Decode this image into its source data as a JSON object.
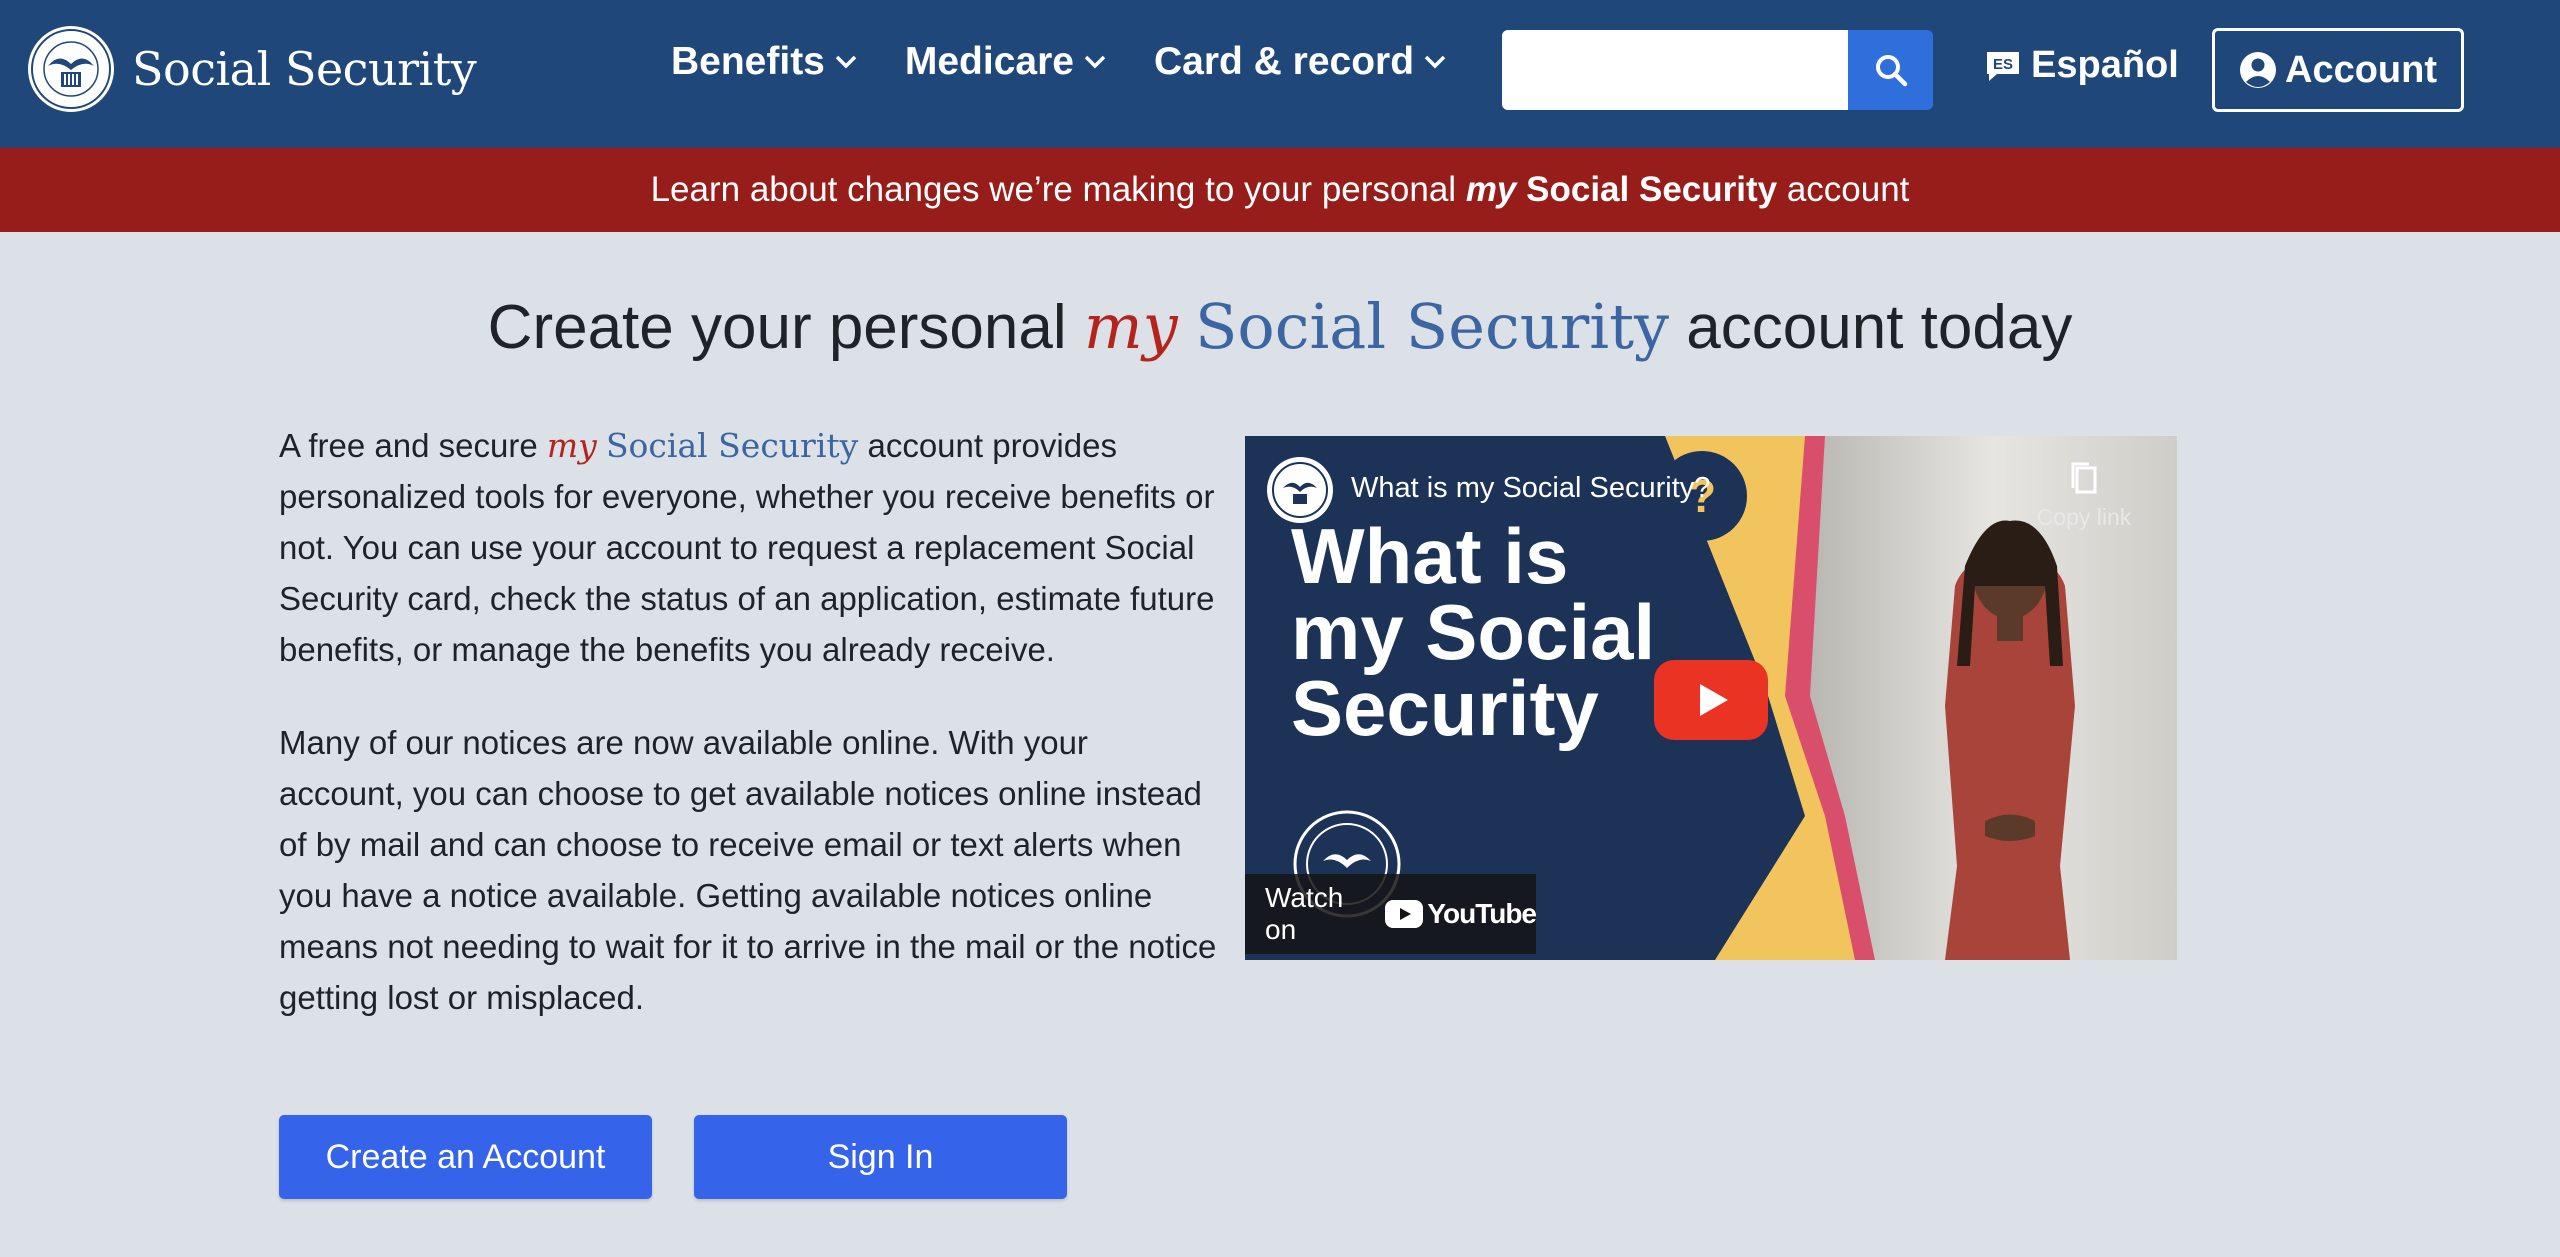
{
  "header": {
    "logo_text": "Social Security",
    "nav": [
      {
        "label": "Benefits"
      },
      {
        "label": "Medicare"
      },
      {
        "label": "Card & record"
      }
    ],
    "search_placeholder": "",
    "espanol": "Español",
    "account": "Account"
  },
  "banner": {
    "prefix": "Learn about changes we’re making to your personal ",
    "my": "my",
    "ss": "Social Security",
    "suffix": " account"
  },
  "hero": {
    "prefix": "Create your personal ",
    "my": "my",
    "ss": "Social Security",
    "suffix": " account today"
  },
  "intro": {
    "p1_prefix": "A free and secure ",
    "p1_my": "my",
    "p1_ss": "Social Security",
    "p1_rest": " account provides personalized tools for everyone, whether you receive benefits or not. You can use your account to request a replacement Social Security card, check the status of an application, estimate future benefits, or manage the benefits you already receive.",
    "p2": "Many of our notices are now available online. With your account, you can choose to get available notices online instead of by mail and can choose to receive email or text alerts when you have a notice available. Getting available notices online means not needing to wait for it to arrive in the mail or the notice getting lost or misplaced."
  },
  "buttons": {
    "create": "Create an Account",
    "signin": "Sign In"
  },
  "video": {
    "title": "What is my Social Security?",
    "big_line1": "What is",
    "big_line2": "my Social",
    "big_line3": "Security",
    "copy_link": "Copy link",
    "watch_on": "Watch on",
    "youtube": "YouTube"
  },
  "colors": {
    "header_bg": "#204779",
    "banner_bg": "#961d1a",
    "page_bg": "#dce1e8",
    "button_bg": "#3563e9",
    "my_red": "#b5241c",
    "ss_blue": "#3c66a3"
  }
}
